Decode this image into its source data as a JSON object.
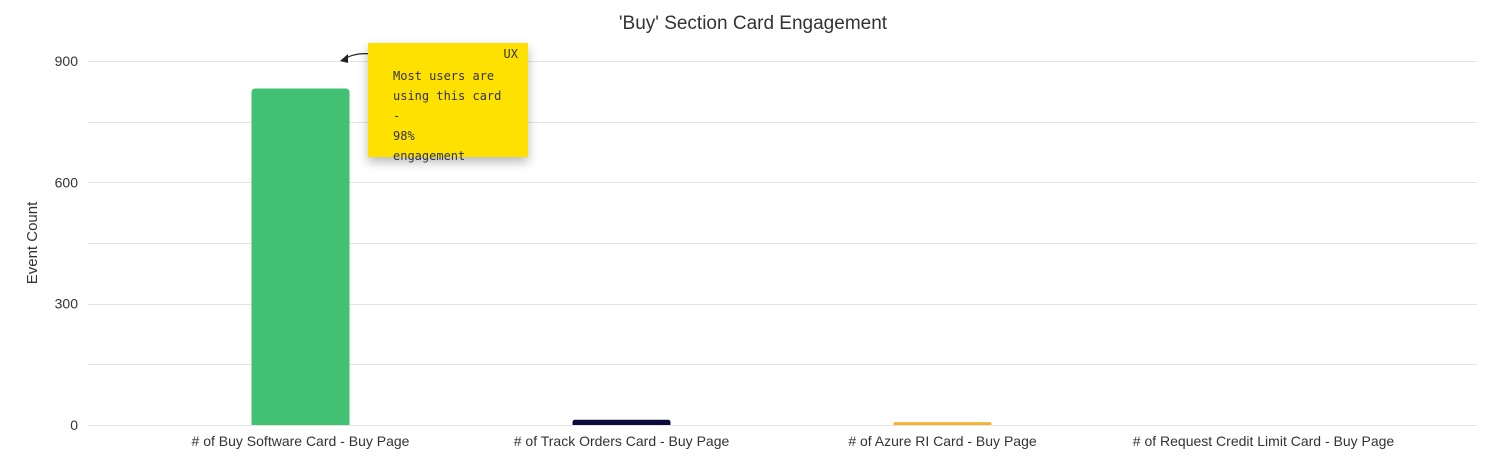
{
  "chart_data": {
    "type": "bar",
    "title": "'Buy' Section Card Engagement",
    "xlabel": "",
    "ylabel": "Event Count",
    "ylim": [
      0,
      900
    ],
    "yticks": [
      0,
      300,
      600,
      900
    ],
    "grid": true,
    "categories": [
      "# of Buy Software Card - Buy Page",
      "# of Track Orders Card - Buy Page",
      "# of Azure RI Card - Buy Page",
      "# of Request Credit Limit Card - Buy Page"
    ],
    "values": [
      832,
      13,
      7,
      0
    ],
    "colors": [
      "#42c172",
      "#0f0a3c",
      "#f2b534",
      "#9aa0a6"
    ]
  },
  "annotation": {
    "tag": "UX",
    "text": "Most users are\nusing this card -\n98%\nengagement"
  }
}
